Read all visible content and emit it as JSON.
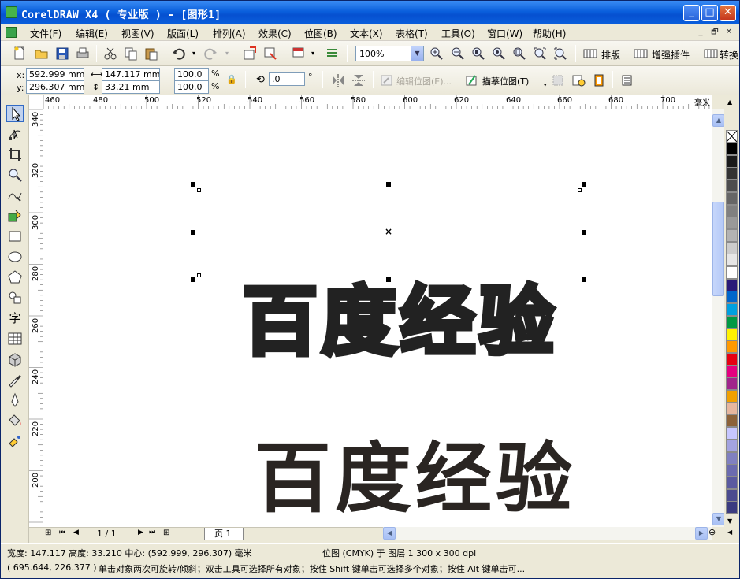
{
  "window": {
    "title": "CorelDRAW X4 ( 专业版 ) - [图形1]",
    "controls": {
      "minimize": "_",
      "maximize": "□",
      "close": "✕"
    }
  },
  "menubar": {
    "items": [
      "文件(F)",
      "编辑(E)",
      "视图(V)",
      "版面(L)",
      "排列(A)",
      "效果(C)",
      "位图(B)",
      "文本(X)",
      "表格(T)",
      "工具(O)",
      "窗口(W)",
      "帮助(H)"
    ],
    "mdi": {
      "minimize": "_",
      "restore": "🗗",
      "close": "✕"
    }
  },
  "toolbar_standard": {
    "zoom_value": "100%",
    "plugins": [
      "排版",
      "增强插件",
      "转换"
    ]
  },
  "property_bar": {
    "x_label": "x:",
    "x_value": "592.999 mm",
    "y_label": "y:",
    "y_value": "296.307 mm",
    "width_value": "147.117 mm",
    "height_value": "33.21 mm",
    "scale_x": "100.0",
    "scale_y": "100.0",
    "percent": "%",
    "rotation_value": ".0",
    "degree": "°",
    "edit_bitmap": "编辑位图(E)...",
    "trace_bitmap": "描摹位图(T)"
  },
  "ruler_h": [
    "460",
    "480",
    "500",
    "520",
    "540",
    "560",
    "580",
    "600",
    "620",
    "640",
    "660",
    "680",
    "700"
  ],
  "ruler_v": [
    "340",
    "320",
    "300",
    "280",
    "260",
    "240",
    "220",
    "200"
  ],
  "ruler_unit": "毫米",
  "canvas": {
    "text_outline": "百度经验",
    "text_solid": "百度经验"
  },
  "page_nav": {
    "current": "1 / 1",
    "tab": "页 1"
  },
  "palette": {
    "colors": [
      "#ffffff",
      "#000000",
      "#1a1a1a",
      "#333333",
      "#4d4d4d",
      "#666666",
      "#808080",
      "#999999",
      "#b3b3b3",
      "#cccccc",
      "#e6e6e6",
      "#ffffff",
      "#2a1a78",
      "#0066cc",
      "#00a0e0",
      "#009944",
      "#fff200",
      "#ff9900",
      "#e60012",
      "#e4007f",
      "#a0268b",
      "#f0a000",
      "#e6b69e",
      "#8c6239",
      "#c6c6ff",
      "#a3a3e0",
      "#8080c0",
      "#6b6baf",
      "#5a5aa0",
      "#4b4b8f",
      "#3b3b80"
    ]
  },
  "status": {
    "dimensions": "宽度: 147.117 高度: 33.210 中心: (592.999, 296.307) 毫米",
    "object_info": "位图 (CMYK) 于 图层 1 300 x 300 dpi",
    "cursor": "( 695.644, 226.377 )",
    "hint": "单击对象两次可旋转/倾斜；双击工具可选择所有对象；按住 Shift 键单击可选择多个对象；按住 Alt 键单击可..."
  }
}
